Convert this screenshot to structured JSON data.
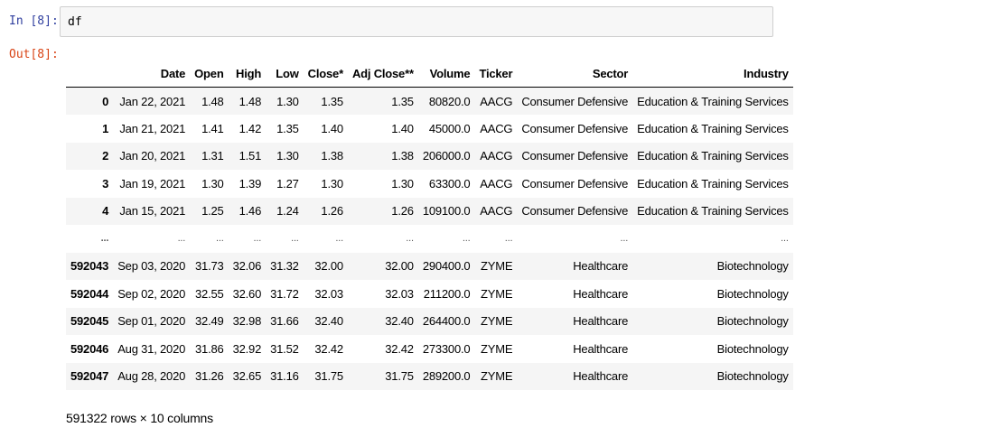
{
  "input": {
    "prompt": "In [8]:",
    "code": "df"
  },
  "output": {
    "prompt": "Out[8]:"
  },
  "table": {
    "index_header": "",
    "columns": [
      "Date",
      "Open",
      "High",
      "Low",
      "Close*",
      "Adj Close**",
      "Volume",
      "Ticker",
      "Sector",
      "Industry"
    ],
    "rows": [
      {
        "index": "0",
        "cells": [
          "Jan 22, 2021",
          "1.48",
          "1.48",
          "1.30",
          "1.35",
          "1.35",
          "80820.0",
          "AACG",
          "Consumer Defensive",
          "Education & Training Services"
        ]
      },
      {
        "index": "1",
        "cells": [
          "Jan 21, 2021",
          "1.41",
          "1.42",
          "1.35",
          "1.40",
          "1.40",
          "45000.0",
          "AACG",
          "Consumer Defensive",
          "Education & Training Services"
        ]
      },
      {
        "index": "2",
        "cells": [
          "Jan 20, 2021",
          "1.31",
          "1.51",
          "1.30",
          "1.38",
          "1.38",
          "206000.0",
          "AACG",
          "Consumer Defensive",
          "Education & Training Services"
        ]
      },
      {
        "index": "3",
        "cells": [
          "Jan 19, 2021",
          "1.30",
          "1.39",
          "1.27",
          "1.30",
          "1.30",
          "63300.0",
          "AACG",
          "Consumer Defensive",
          "Education & Training Services"
        ]
      },
      {
        "index": "4",
        "cells": [
          "Jan 15, 2021",
          "1.25",
          "1.46",
          "1.24",
          "1.26",
          "1.26",
          "109100.0",
          "AACG",
          "Consumer Defensive",
          "Education & Training Services"
        ]
      },
      {
        "index": "...",
        "cells": [
          "...",
          "...",
          "...",
          "...",
          "...",
          "...",
          "...",
          "...",
          "...",
          "..."
        ]
      },
      {
        "index": "592043",
        "cells": [
          "Sep 03, 2020",
          "31.73",
          "32.06",
          "31.32",
          "32.00",
          "32.00",
          "290400.0",
          "ZYME",
          "Healthcare",
          "Biotechnology"
        ]
      },
      {
        "index": "592044",
        "cells": [
          "Sep 02, 2020",
          "32.55",
          "32.60",
          "31.72",
          "32.03",
          "32.03",
          "211200.0",
          "ZYME",
          "Healthcare",
          "Biotechnology"
        ]
      },
      {
        "index": "592045",
        "cells": [
          "Sep 01, 2020",
          "32.49",
          "32.98",
          "31.66",
          "32.40",
          "32.40",
          "264400.0",
          "ZYME",
          "Healthcare",
          "Biotechnology"
        ]
      },
      {
        "index": "592046",
        "cells": [
          "Aug 31, 2020",
          "31.86",
          "32.92",
          "31.52",
          "32.42",
          "32.42",
          "273300.0",
          "ZYME",
          "Healthcare",
          "Biotechnology"
        ]
      },
      {
        "index": "592047",
        "cells": [
          "Aug 28, 2020",
          "31.26",
          "32.65",
          "31.16",
          "31.75",
          "31.75",
          "289200.0",
          "ZYME",
          "Healthcare",
          "Biotechnology"
        ]
      }
    ]
  },
  "summary": "591322 rows × 10 columns"
}
